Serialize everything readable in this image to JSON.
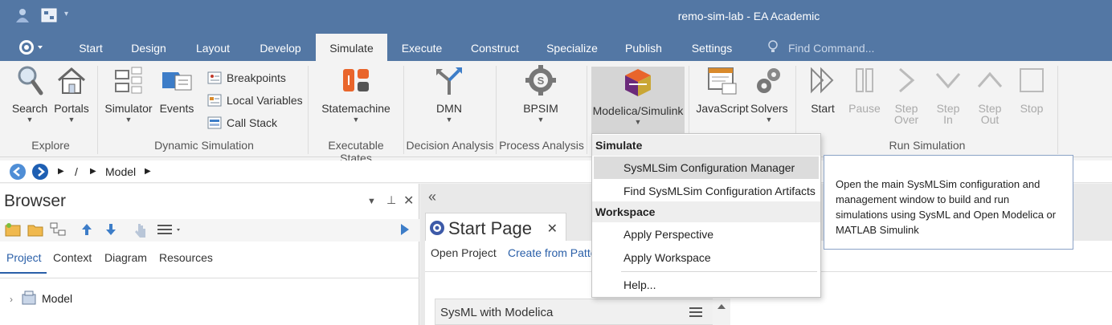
{
  "window": {
    "title": "remo-sim-lab - EA Academic"
  },
  "ribbon_tabs": [
    "Start",
    "Design",
    "Layout",
    "Develop",
    "Simulate",
    "Execute",
    "Construct",
    "Specialize",
    "Publish",
    "Settings"
  ],
  "active_tab": "Simulate",
  "find_command": {
    "placeholder": "Find Command..."
  },
  "ribbon": {
    "explore": {
      "label": "Explore",
      "search": "Search",
      "portals": "Portals"
    },
    "dynamic": {
      "label": "Dynamic Simulation",
      "simulator": "Simulator",
      "events": "Events",
      "breakpoints": "Breakpoints",
      "local_vars": "Local Variables",
      "call_stack": "Call Stack"
    },
    "executable": {
      "label": "Executable States",
      "statemachine": "Statemachine"
    },
    "decision": {
      "label": "Decision Analysis",
      "dmn": "DMN"
    },
    "process": {
      "label": "Process Analysis",
      "bpsim": "BPSIM"
    },
    "modelica": {
      "label": "Modelica/Simulink"
    },
    "scripting": {
      "javascript": "JavaScript",
      "solvers": "Solvers"
    },
    "run": {
      "label": "Run Simulation",
      "start": "Start",
      "pause": "Pause",
      "step_over_1": "Step",
      "step_over_2": "Over",
      "step_in_1": "Step",
      "step_in_2": "In",
      "step_out_1": "Step",
      "step_out_2": "Out",
      "stop": "Stop"
    }
  },
  "address": {
    "sep": "/",
    "model": "Model"
  },
  "browser": {
    "title": "Browser",
    "tabs": [
      "Project",
      "Context",
      "Diagram",
      "Resources"
    ],
    "tree_root": "Model"
  },
  "start_page": {
    "tab_title": "Start Page",
    "links": [
      "Open Project",
      "Create from Patte"
    ],
    "panel_title": "SysML with Modelica"
  },
  "dropdown": {
    "section1": "Simulate",
    "item1": "SysMLSim Configuration Manager",
    "item2": "Find SysMLSim Configuration Artifacts",
    "section2": "Workspace",
    "item3": "Apply Perspective",
    "item4": "Apply Workspace",
    "item5": "Help..."
  },
  "tooltip": "Open the main SysMLSim configuration and management window to build and run simulations using SysML and Open Modelica or MATLAB Simulink",
  "colors": {
    "title_bar": "#5377a4",
    "accent": "#2a5fa8"
  }
}
